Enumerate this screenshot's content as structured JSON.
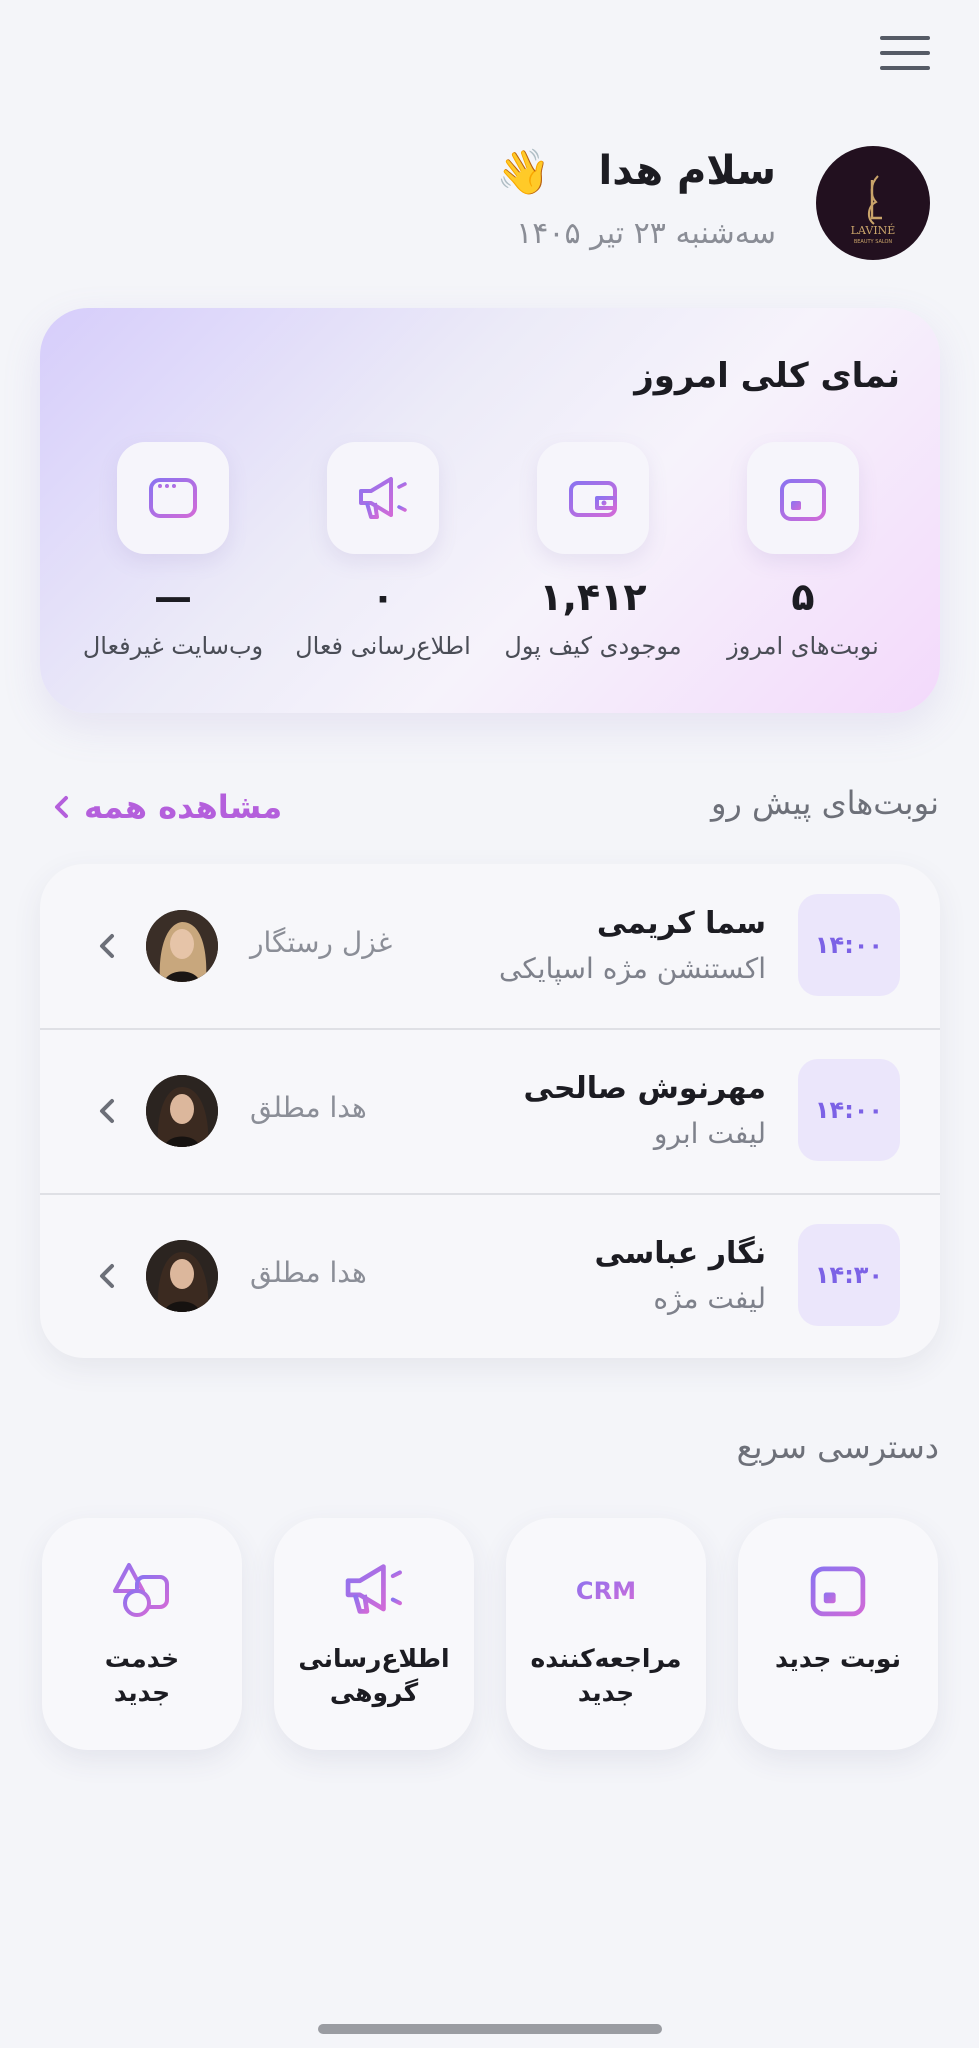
{
  "header": {
    "greeting": "سلام هدا",
    "wave_emoji": "👋",
    "date": "سه‌شنبه ۲۳ تیر ۱۴۰۵",
    "logo_text": "LAVINÉ",
    "logo_subtext": "BEAUTY SALON"
  },
  "overview": {
    "title": "نمای کلی امروز",
    "stats": [
      {
        "icon": "calendar-icon",
        "value": "۵",
        "label": "نوبت‌های امروز"
      },
      {
        "icon": "wallet-icon",
        "value": "۱,۴۱۲",
        "label": "موجودی کیف پول"
      },
      {
        "icon": "megaphone-icon",
        "value": "۰",
        "label": "اطلاع‌رسانی فعال"
      },
      {
        "icon": "browser-icon",
        "value": "—",
        "label": "وب‌سایت غیرفعال"
      }
    ]
  },
  "upcoming": {
    "title": "نوبت‌های پیش رو",
    "see_all": "مشاهده همه",
    "items": [
      {
        "time": "۱۴:۰۰",
        "client": "سما کریمی",
        "service": "اکستنشن مژه اسپایکی",
        "staff": "غزل رستگار"
      },
      {
        "time": "۱۴:۰۰",
        "client": "مهرنوش صالحی",
        "service": "لیفت ابرو",
        "staff": "هدا مطلق"
      },
      {
        "time": "۱۴:۳۰",
        "client": "نگار عباسی",
        "service": "لیفت مژه",
        "staff": "هدا مطلق"
      }
    ]
  },
  "quick_access": {
    "title": "دسترسی سریع",
    "tiles": [
      {
        "icon": "calendar-icon",
        "label_line1": "نوبت جدید",
        "label_line2": ""
      },
      {
        "icon": "crm-icon",
        "icon_text": "CRM",
        "label_line1": "مراجعه‌کننده",
        "label_line2": "جدید"
      },
      {
        "icon": "megaphone-icon",
        "label_line1": "اطلاع‌رسانی",
        "label_line2": "گروهی"
      },
      {
        "icon": "shapes-icon",
        "label_line1": "خدمت",
        "label_line2": "جدید"
      }
    ]
  },
  "colors": {
    "accent": "#b45fdc",
    "badge_bg": "#ebe6fb",
    "badge_text": "#7c62e6",
    "background": "#f4f5f9"
  }
}
